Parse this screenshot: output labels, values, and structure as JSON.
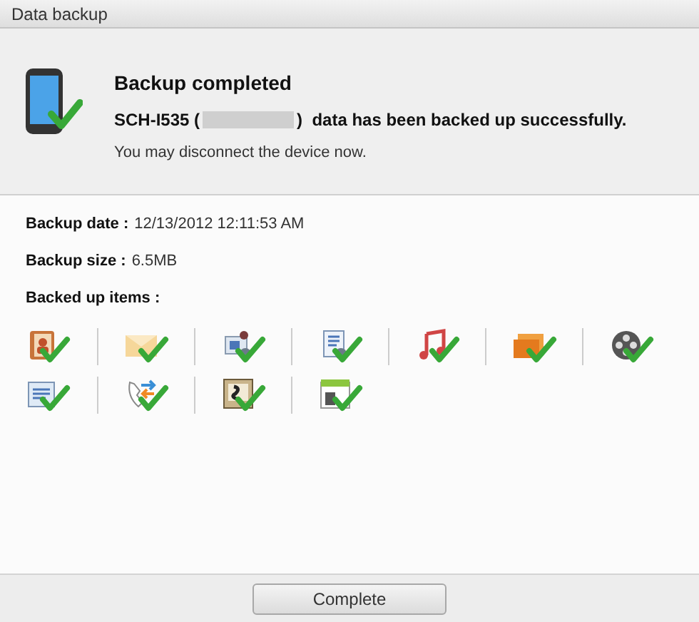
{
  "window": {
    "title": "Data backup"
  },
  "header": {
    "title": "Backup completed",
    "message_before": "SCH-I535 (",
    "message_after": ")  data has been backed up successfully.",
    "note": "You may disconnect the device now."
  },
  "details": [
    {
      "label": "Backup date :",
      "value": "12/13/2012 12:11:53 AM"
    },
    {
      "label": "Backup size :",
      "value": "6.5MB"
    }
  ],
  "items_label": "Backed up items :",
  "items": [
    {
      "kind": "contacts",
      "checked": true
    },
    {
      "kind": "message",
      "checked": true
    },
    {
      "kind": "image-gear",
      "checked": true
    },
    {
      "kind": "document-gear",
      "checked": true
    },
    {
      "kind": "music",
      "checked": true
    },
    {
      "kind": "photos",
      "checked": true
    },
    {
      "kind": "video",
      "checked": true
    },
    {
      "kind": "memo",
      "checked": true
    },
    {
      "kind": "call-log",
      "checked": true
    },
    {
      "kind": "app",
      "checked": true
    },
    {
      "kind": "calendar",
      "checked": true
    }
  ],
  "button": "Complete"
}
